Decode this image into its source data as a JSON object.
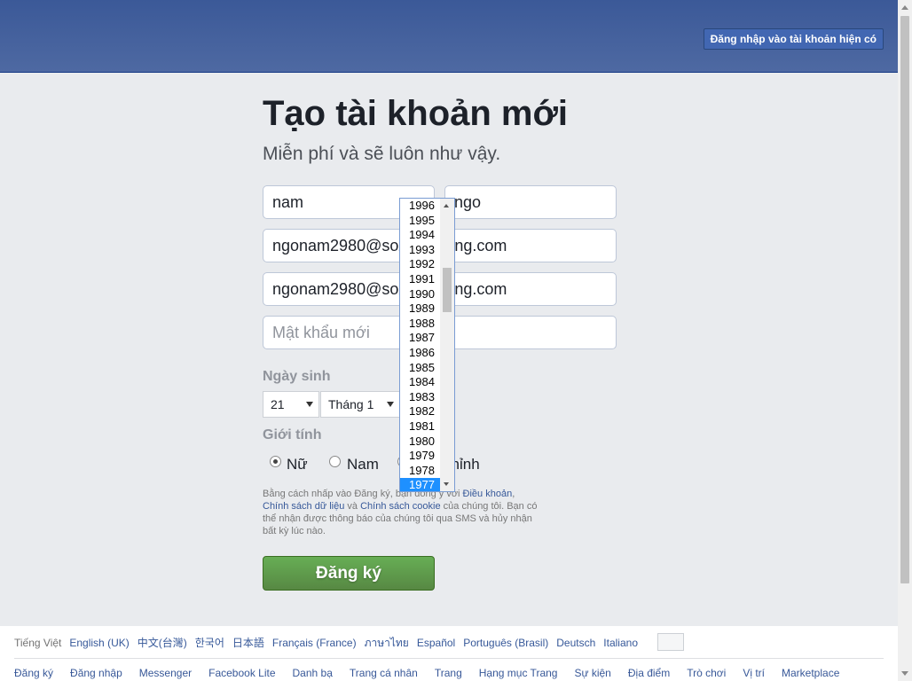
{
  "header": {
    "login_button": "Đăng nhập vào tài khoản hiện có"
  },
  "form": {
    "title": "Tạo tài khoản mới",
    "subtitle": "Miễn phí và sẽ luôn như vậy.",
    "first_name": {
      "value": "nam"
    },
    "last_name": {
      "value": "ngo"
    },
    "email": {
      "value": "ngonam2980@soxxxxxxxng.com"
    },
    "email_confirm": {
      "value": "ngonam2980@soxxxxxxxng.com"
    },
    "password": {
      "placeholder": "Mật khẩu mới"
    },
    "birthday_label": "Ngày sinh",
    "day_selected": "21",
    "month_selected": "Tháng 1",
    "gender_label": "Giới tính",
    "gender_options": [
      "Nữ",
      "Nam",
      "Tùy chỉnh"
    ],
    "gender_selected": "Nữ",
    "terms": {
      "part1": "Bằng cách nhấp vào Đăng ký, bạn đồng ý với ",
      "link_terms": "Điều khoản",
      "sep": ", ",
      "link_data": "Chính sách dữ liệu",
      "and": " và ",
      "link_cookie": "Chính sách cookie",
      "part2": " của chúng tôi. Bạn có thể nhận được thông báo của chúng tôi qua SMS và hủy nhận bất kỳ lúc nào."
    },
    "signup_button": "Đăng ký"
  },
  "year_dropdown": {
    "years": [
      "1996",
      "1995",
      "1994",
      "1993",
      "1992",
      "1991",
      "1990",
      "1989",
      "1988",
      "1987",
      "1986",
      "1985",
      "1984",
      "1983",
      "1982",
      "1981",
      "1980",
      "1979",
      "1978",
      "1977"
    ],
    "selected": "1977"
  },
  "footer": {
    "languages": [
      "Tiếng Việt",
      "English (UK)",
      "中文(台灣)",
      "한국어",
      "日本語",
      "Français (France)",
      "ภาษาไทย",
      "Español",
      "Português (Brasil)",
      "Deutsch",
      "Italiano"
    ],
    "links": [
      "Đăng ký",
      "Đăng nhập",
      "Messenger",
      "Facebook Lite",
      "Danh bạ",
      "Trang cá nhân",
      "Trang",
      "Hạng mục Trang",
      "Sự kiện",
      "Địa điểm",
      "Trò chơi",
      "Vị trí",
      "Marketplace"
    ]
  },
  "colors": {
    "header_blue": "#3b5998",
    "signup_green": "#5f9f4a",
    "link_blue": "#365899",
    "selected_year": "#1e90ff"
  }
}
